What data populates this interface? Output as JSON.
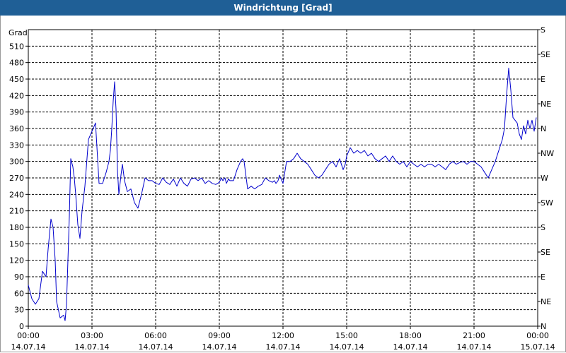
{
  "window": {
    "title": "Windrichtung [Grad]"
  },
  "chart_data": {
    "type": "line",
    "title": "Windrichtung [Grad]",
    "ylabel": "Grad",
    "ylim": [
      0,
      540
    ],
    "xlim": [
      0,
      1440
    ],
    "grid": true,
    "line_color": "#0000cc",
    "y_ticks": [
      0,
      30,
      60,
      90,
      120,
      150,
      180,
      210,
      240,
      270,
      300,
      330,
      360,
      390,
      420,
      450,
      480,
      510
    ],
    "y2_ticks": [
      {
        "value": 0,
        "label": "N"
      },
      {
        "value": 45,
        "label": "NE"
      },
      {
        "value": 90,
        "label": "E"
      },
      {
        "value": 135,
        "label": "SE"
      },
      {
        "value": 180,
        "label": "S"
      },
      {
        "value": 225,
        "label": "SW"
      },
      {
        "value": 270,
        "label": "W"
      },
      {
        "value": 315,
        "label": "NW"
      },
      {
        "value": 360,
        "label": "N"
      },
      {
        "value": 405,
        "label": "NE"
      },
      {
        "value": 450,
        "label": "E"
      },
      {
        "value": 495,
        "label": "SE"
      },
      {
        "value": 540,
        "label": "S"
      }
    ],
    "x_ticks": [
      {
        "minutes": 0,
        "time": "00:00",
        "date": "14.07.14"
      },
      {
        "minutes": 180,
        "time": "03:00",
        "date": "14.07.14"
      },
      {
        "minutes": 360,
        "time": "06:00",
        "date": "14.07.14"
      },
      {
        "minutes": 540,
        "time": "09:00",
        "date": "14.07.14"
      },
      {
        "minutes": 720,
        "time": "12:00",
        "date": "14.07.14"
      },
      {
        "minutes": 900,
        "time": "15:00",
        "date": "14.07.14"
      },
      {
        "minutes": 1080,
        "time": "18:00",
        "date": "14.07.14"
      },
      {
        "minutes": 1260,
        "time": "21:00",
        "date": "14.07.14"
      },
      {
        "minutes": 1440,
        "time": "00:00",
        "date": "15.07.14"
      }
    ],
    "series": [
      {
        "x": [
          0,
          10,
          20,
          30,
          40,
          50,
          56,
          64,
          70,
          76,
          80,
          90,
          100,
          104,
          108,
          112,
          116,
          120,
          126,
          130,
          134,
          140,
          146,
          152,
          160,
          170,
          180,
          190,
          200,
          210,
          220,
          228,
          232,
          236,
          240,
          244,
          248,
          252,
          256,
          262,
          266,
          272,
          280,
          290,
          300,
          310,
          320,
          330,
          340,
          350,
          360,
          370,
          380,
          390,
          400,
          410,
          420,
          430,
          440,
          450,
          460,
          470,
          480,
          490,
          500,
          510,
          520,
          530,
          540,
          546,
          550,
          556,
          560,
          566,
          570,
          580,
          590,
          600,
          606,
          610,
          620,
          630,
          640,
          650,
          660,
          670,
          680,
          690,
          696,
          700,
          706,
          710,
          720,
          730,
          740,
          750,
          760,
          770,
          780,
          790,
          800,
          810,
          820,
          830,
          840,
          850,
          860,
          870,
          880,
          890,
          896,
          900,
          910,
          920,
          930,
          940,
          950,
          960,
          970,
          980,
          990,
          1000,
          1010,
          1020,
          1030,
          1040,
          1050,
          1060,
          1070,
          1080,
          1090,
          1100,
          1110,
          1120,
          1130,
          1140,
          1150,
          1160,
          1170,
          1180,
          1190,
          1200,
          1210,
          1220,
          1230,
          1240,
          1250,
          1260,
          1270,
          1280,
          1290,
          1300,
          1310,
          1320,
          1330,
          1340,
          1346,
          1352,
          1358,
          1364,
          1370,
          1376,
          1382,
          1388,
          1394,
          1400,
          1406,
          1412,
          1418,
          1424,
          1430,
          1436
        ],
        "y": [
          75,
          50,
          40,
          50,
          100,
          90,
          140,
          195,
          180,
          120,
          45,
          15,
          20,
          10,
          40,
          120,
          200,
          305,
          290,
          270,
          240,
          185,
          160,
          210,
          255,
          340,
          355,
          370,
          260,
          260,
          280,
          300,
          320,
          360,
          410,
          445,
          395,
          285,
          240,
          275,
          295,
          265,
          245,
          250,
          225,
          215,
          240,
          270,
          265,
          265,
          260,
          258,
          270,
          262,
          258,
          268,
          255,
          270,
          260,
          255,
          268,
          270,
          265,
          270,
          260,
          265,
          260,
          258,
          262,
          270,
          265,
          270,
          260,
          268,
          265,
          265,
          285,
          300,
          305,
          300,
          250,
          255,
          250,
          255,
          258,
          270,
          265,
          262,
          265,
          260,
          265,
          275,
          260,
          300,
          300,
          305,
          315,
          305,
          300,
          295,
          285,
          275,
          270,
          275,
          285,
          295,
          300,
          290,
          305,
          285,
          295,
          310,
          325,
          315,
          320,
          315,
          320,
          310,
          315,
          305,
          300,
          305,
          310,
          300,
          310,
          300,
          295,
          300,
          290,
          300,
          295,
          290,
          295,
          290,
          295,
          295,
          290,
          295,
          290,
          285,
          295,
          300,
          295,
          298,
          300,
          295,
          300,
          300,
          295,
          290,
          280,
          270,
          285,
          300,
          320,
          340,
          360,
          420,
          470,
          430,
          380,
          375,
          370,
          350,
          340,
          365,
          350,
          375,
          360,
          375,
          355,
          380
        ]
      }
    ]
  }
}
